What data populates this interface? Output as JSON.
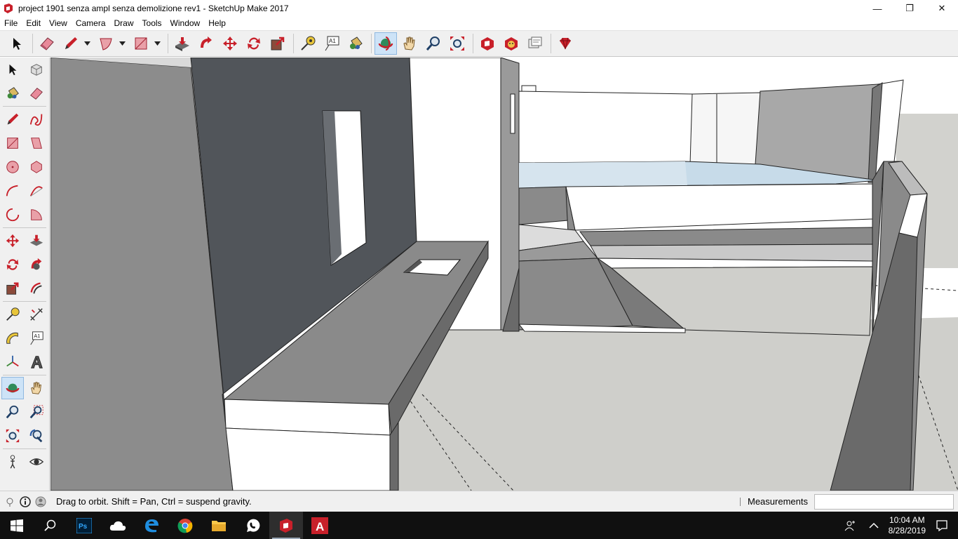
{
  "window": {
    "title": "project 1901 senza ampl senza demolizione rev1 - SketchUp Make 2017",
    "minimize_glyph": "—",
    "restore_glyph": "❐",
    "close_glyph": "✕"
  },
  "menu": [
    {
      "id": "file",
      "label": "File"
    },
    {
      "id": "edit",
      "label": "Edit"
    },
    {
      "id": "view",
      "label": "View"
    },
    {
      "id": "camera",
      "label": "Camera"
    },
    {
      "id": "draw",
      "label": "Draw"
    },
    {
      "id": "tools",
      "label": "Tools"
    },
    {
      "id": "window",
      "label": "Window"
    },
    {
      "id": "help",
      "label": "Help"
    }
  ],
  "toolbar": {
    "tools": [
      "select-icon",
      "eraser-icon",
      "pencil-icon",
      "arc-icon",
      "rectangle-icon",
      "push-pull-icon",
      "follow-me-icon",
      "move-icon",
      "rotate-icon",
      "scale-icon",
      "tape-measure-icon",
      "text-icon",
      "paint-bucket-icon",
      "orbit-icon",
      "pan-icon",
      "zoom-icon",
      "zoom-extents-icon",
      "3d-warehouse-icon",
      "extension-warehouse-icon",
      "layout-icon",
      "ruby-console-icon"
    ],
    "active_tool": "orbit-icon",
    "text_tool_label": "A1"
  },
  "left_toolbar": {
    "text_tool_label": "A1"
  },
  "statusbar": {
    "hint": "Drag to orbit. Shift = Pan, Ctrl = suspend gravity.",
    "measurements_label": "Measurements",
    "measurements_value": ""
  },
  "taskbar": {
    "time": "10:04 AM",
    "date": "8/28/2019",
    "apps": [
      "start-icon",
      "search-icon",
      "photoshop-icon",
      "onedrive-icon",
      "edge-icon",
      "chrome-icon",
      "file-explorer-icon",
      "whatsapp-icon",
      "sketchup-icon",
      "autocad-icon"
    ],
    "active_app": "sketchup-icon",
    "photoshop_label": "Ps",
    "autocad_label": "A"
  },
  "colors": {
    "accent": "#cde3f7",
    "sketchup_red": "#c8202a",
    "wall_dark": "#51555a",
    "ground": "#cfcfcb",
    "face_grey": "#8a8a8a",
    "taskbar": "#101010"
  }
}
